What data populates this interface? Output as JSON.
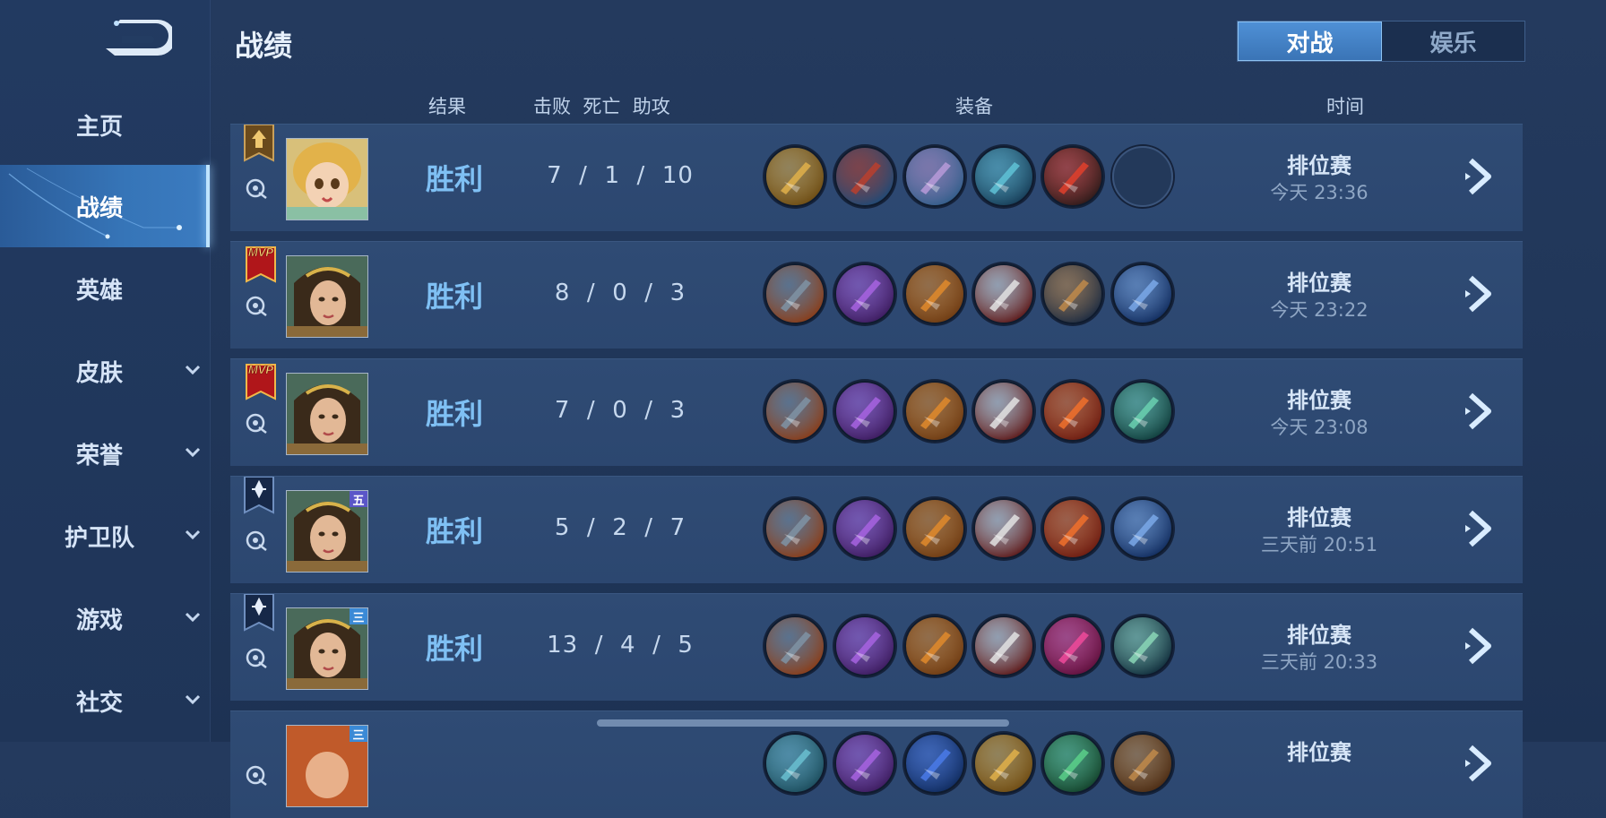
{
  "sidebar": {
    "items": [
      {
        "label": "主页",
        "icon": "none",
        "expandable": false,
        "active": false
      },
      {
        "label": "战绩",
        "icon": "none",
        "expandable": false,
        "active": true
      },
      {
        "label": "英雄",
        "icon": "none",
        "expandable": false,
        "active": false
      },
      {
        "label": "皮肤",
        "icon": "chevron-down-icon",
        "expandable": true,
        "active": false
      },
      {
        "label": "荣誉",
        "icon": "chevron-down-icon",
        "expandable": true,
        "active": false
      },
      {
        "label": "护卫队",
        "icon": "chevron-down-icon",
        "expandable": true,
        "active": false
      },
      {
        "label": "游戏",
        "icon": "chevron-down-icon",
        "expandable": true,
        "active": false
      },
      {
        "label": "社交",
        "icon": "chevron-down-icon",
        "expandable": true,
        "active": false
      }
    ]
  },
  "header": {
    "title": "战绩",
    "tabs": [
      {
        "label": "对战",
        "active": true
      },
      {
        "label": "娱乐",
        "active": false
      }
    ]
  },
  "columns": {
    "result": "结果",
    "kda": "击败  死亡  助攻",
    "equipment": "装备",
    "time": "时间"
  },
  "colors": {
    "accent": "#3a74b6",
    "result_text": "#7fc0f4",
    "row_bg": "#2f4b74",
    "page_bg": "#21375a"
  },
  "matches": [
    {
      "badge": "gold-banner-icon",
      "tier": "",
      "hero": "blonde-hero-portrait",
      "result": "胜利",
      "kda": "7  /  1  /  10",
      "items": [
        "gold-amulet-item-icon",
        "red-bracer-item-icon",
        "purple-mask-item-icon",
        "teal-axe-item-icon",
        "red-gem-item-icon",
        "empty-slot"
      ],
      "mode": "排位赛",
      "time": "今天 23:36"
    },
    {
      "badge": "mvp-badge-icon",
      "badge_text": "MVP",
      "tier": "",
      "hero": "laurel-hero-portrait",
      "result": "胜利",
      "kda": "8  /  0  /  3",
      "items": [
        "steel-boots-item-icon",
        "purple-axe-item-icon",
        "gold-blade-item-icon",
        "red-sword-item-icon",
        "gauntlet-item-icon",
        "blue-bow-item-icon"
      ],
      "mode": "排位赛",
      "time": "今天 23:22"
    },
    {
      "badge": "mvp-badge-icon",
      "badge_text": "MVP",
      "tier": "",
      "hero": "laurel-hero-portrait",
      "result": "胜利",
      "kda": "7  /  0  /  3",
      "items": [
        "steel-boots-item-icon",
        "purple-axe-item-icon",
        "gold-blade-item-icon",
        "red-sword-item-icon",
        "flame-spear-item-icon",
        "green-dagger-item-icon"
      ],
      "mode": "排位赛",
      "time": "今天 23:08"
    },
    {
      "badge": "blue-banner-icon",
      "tier": "五",
      "tier_color": "#5b56c8",
      "hero": "laurel-hero-portrait",
      "result": "胜利",
      "kda": "5  /  2  /  7",
      "items": [
        "steel-boots-item-icon",
        "purple-axe-item-icon",
        "gold-blade-item-icon",
        "red-sword-item-icon",
        "flame-spear-item-icon",
        "blue-bow-item-icon"
      ],
      "mode": "排位赛",
      "time": "三天前 20:51"
    },
    {
      "badge": "blue-banner-icon",
      "tier": "三",
      "tier_color": "#3b8ad6",
      "hero": "laurel-hero-portrait",
      "result": "胜利",
      "kda": "13  /  4  /  5",
      "items": [
        "steel-boots-item-icon",
        "purple-axe-item-icon",
        "gold-blade-item-icon",
        "red-sword-item-icon",
        "pink-spear-item-icon",
        "green-greatsword-item-icon"
      ],
      "mode": "排位赛",
      "time": "三天前 20:33"
    },
    {
      "badge": "",
      "tier": "三",
      "tier_color": "#3b8ad6",
      "hero": "red-hero-portrait",
      "result": "",
      "kda": "",
      "items": [
        "teal-item-icon",
        "purple-item-icon",
        "blue-item-icon",
        "gold-item-icon",
        "green-item-icon",
        "brown-item-icon"
      ],
      "mode": "排位赛",
      "time": ""
    }
  ]
}
